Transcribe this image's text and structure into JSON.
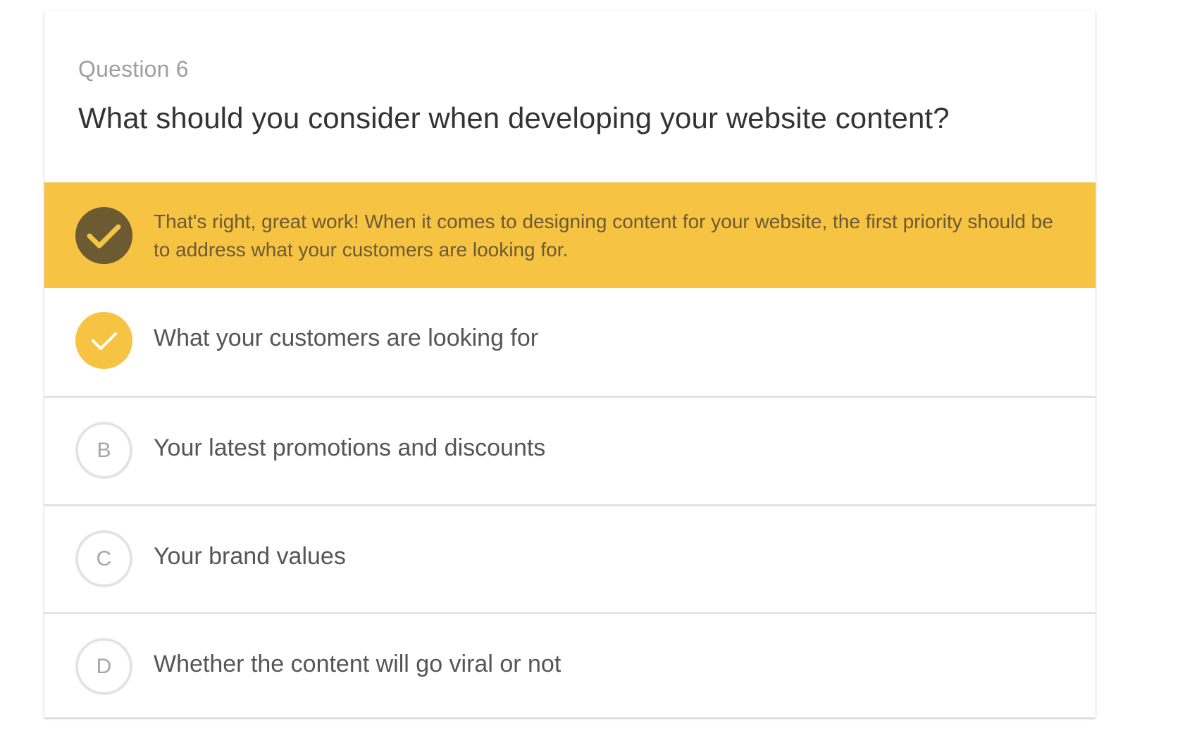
{
  "question": {
    "label": "Question 6",
    "title": "What should you consider when developing your website content?"
  },
  "feedback": {
    "text": "That's right, great work! When it comes to designing content for your website, the first priority should be to address what your customers are looking for.",
    "icon": "checkmark-icon",
    "background_color": "#f6c343",
    "icon_background_color": "#6b5a32"
  },
  "options": [
    {
      "letter": "",
      "label": "What your customers are looking for",
      "state": "correct",
      "icon": "checkmark-icon"
    },
    {
      "letter": "B",
      "label": "Your latest promotions and discounts",
      "state": "unselected"
    },
    {
      "letter": "C",
      "label": "Your brand values",
      "state": "unselected"
    },
    {
      "letter": "D",
      "label": "Whether the content will go viral or not",
      "state": "unselected"
    }
  ],
  "colors": {
    "accent": "#f6c343",
    "accent_dark": "#6b5a32",
    "text_primary": "#333333",
    "text_secondary": "#555555",
    "muted": "#9e9e9e",
    "divider": "#e3e3e3"
  }
}
